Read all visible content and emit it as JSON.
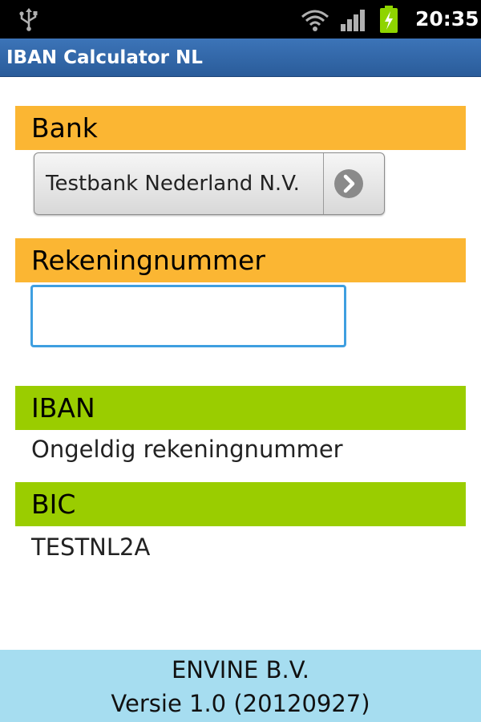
{
  "status_bar": {
    "time": "20:35",
    "icons": [
      "usb-icon",
      "wifi-icon",
      "signal-icon",
      "battery-charging-icon"
    ]
  },
  "app": {
    "title": "IBAN Calculator NL"
  },
  "sections": {
    "bank": {
      "header": "Bank",
      "selected_value": "Testbank Nederland N.V.",
      "arrow_icon": "chevron-right-icon"
    },
    "account_number": {
      "header": "Rekeningnummer",
      "value": "",
      "placeholder": ""
    },
    "iban": {
      "header": "IBAN",
      "value": "Ongeldig rekeningnummer"
    },
    "bic": {
      "header": "BIC",
      "value": "TESTNL2A"
    }
  },
  "footer": {
    "company": "ENVINE B.V.",
    "version": "Versie 1.0 (20120927)"
  },
  "colors": {
    "status_bar_bg": "#000000",
    "title_bar_bg": "#2f64a6",
    "header_orange": "#fbb633",
    "header_green": "#9acd00",
    "input_focus_border": "#3f9fe0",
    "footer_bg": "#a6ddf0"
  }
}
